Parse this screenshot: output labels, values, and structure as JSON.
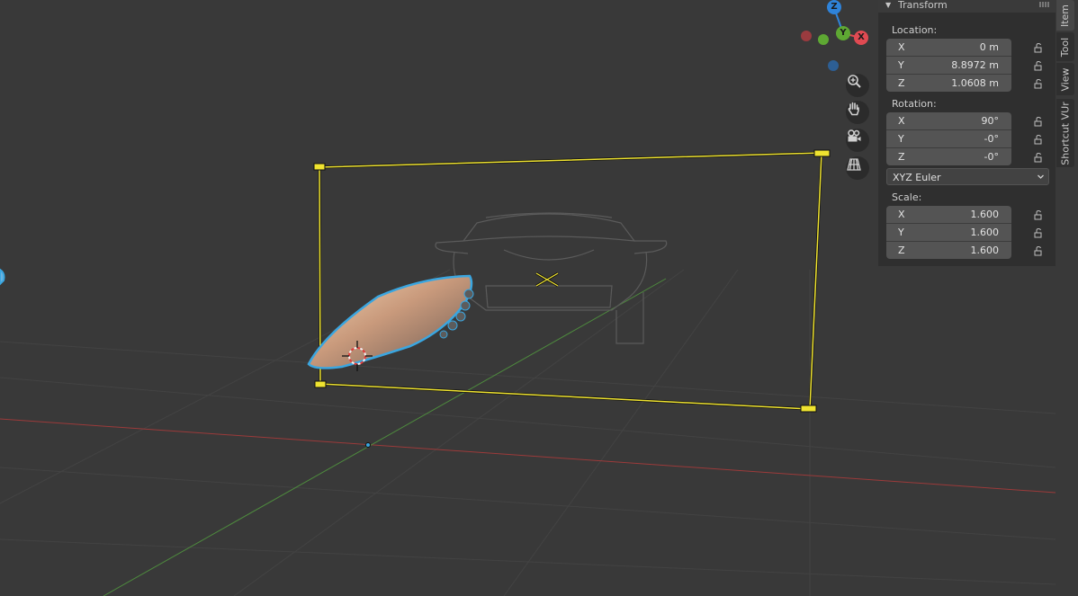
{
  "gizmo": {
    "z_label": "Z",
    "y_label": "Y",
    "x_label": "X",
    "colors": {
      "x": "#e04a52",
      "y": "#5ea833",
      "z": "#2e83da"
    }
  },
  "nav_icons": [
    "zoom-icon",
    "hand-pan-icon",
    "camera-icon",
    "grid-perspective-icon"
  ],
  "panel": {
    "header": "Transform",
    "location_label": "Location:",
    "location": [
      {
        "axis": "X",
        "value": "0 m"
      },
      {
        "axis": "Y",
        "value": "8.8972 m"
      },
      {
        "axis": "Z",
        "value": "1.0608 m"
      }
    ],
    "rotation_label": "Rotation:",
    "rotation": [
      {
        "axis": "X",
        "value": "90°"
      },
      {
        "axis": "Y",
        "value": "-0°"
      },
      {
        "axis": "Z",
        "value": "-0°"
      }
    ],
    "rotation_mode": "XYZ Euler",
    "scale_label": "Scale:",
    "scale": [
      {
        "axis": "X",
        "value": "1.600"
      },
      {
        "axis": "Y",
        "value": "1.600"
      },
      {
        "axis": "Z",
        "value": "1.600"
      }
    ]
  },
  "tabs": [
    "Item",
    "Tool",
    "View",
    "Shortcut VUr"
  ],
  "colors": {
    "background": "#393939",
    "selection_outline": "#3aa6e0",
    "image_frame": "#f0e430",
    "x_axis_line": "#9c3a3a",
    "y_axis_line": "#4e8b3e"
  }
}
